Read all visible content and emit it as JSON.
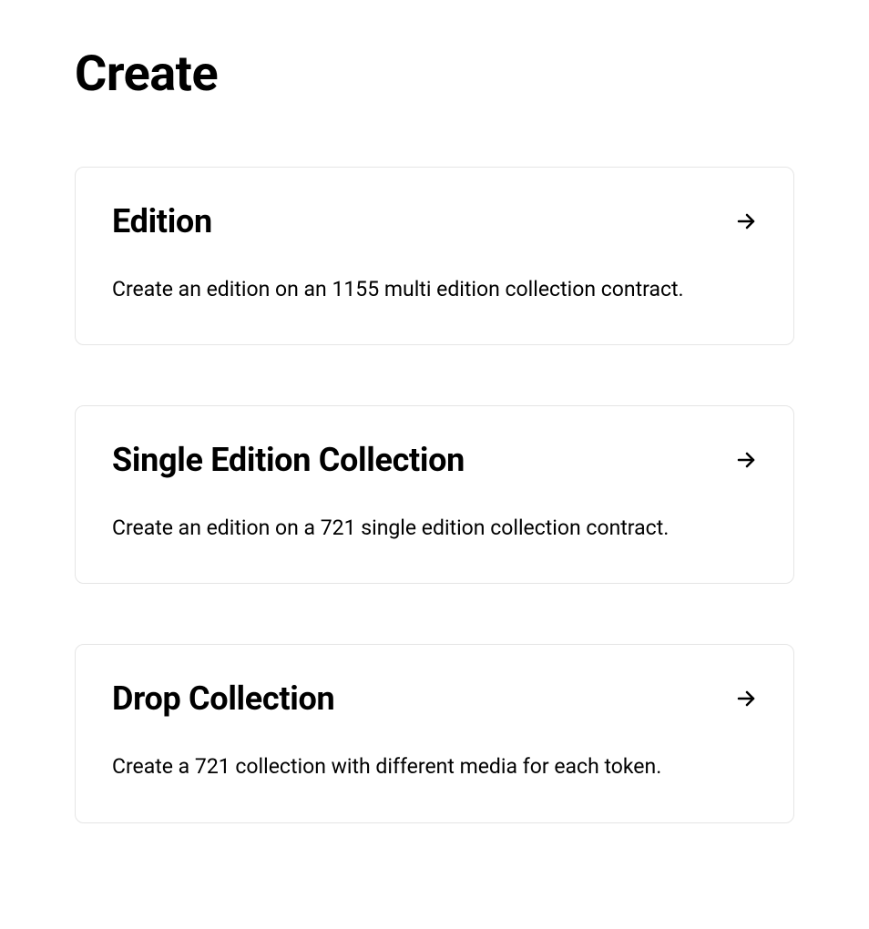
{
  "page": {
    "title": "Create"
  },
  "cards": [
    {
      "title": "Edition",
      "description": "Create an edition on an 1155 multi edition collection contract."
    },
    {
      "title": "Single Edition Collection",
      "description": "Create an edition on a 721 single edition collection contract."
    },
    {
      "title": "Drop Collection",
      "description": "Create a 721 collection with different media for each token."
    }
  ]
}
